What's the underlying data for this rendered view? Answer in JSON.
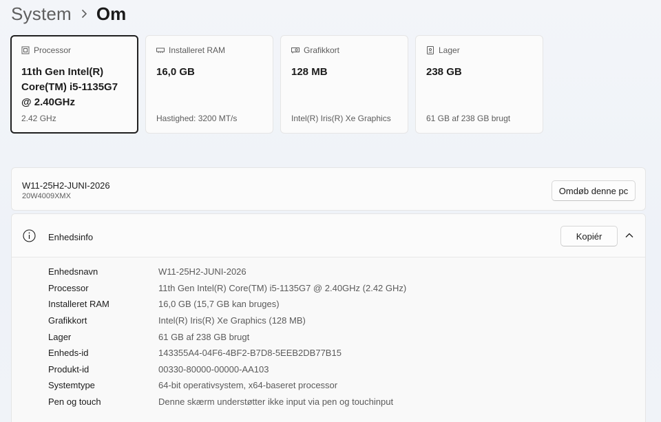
{
  "breadcrumb": {
    "parent": "System",
    "current": "Om"
  },
  "cards": [
    {
      "label": "Processor",
      "value": "11th Gen Intel(R) Core(TM) i5-1135G7 @ 2.40GHz",
      "sub": "2.42 GHz",
      "icon": "cpu-icon"
    },
    {
      "label": "Installeret RAM",
      "value": "16,0 GB",
      "sub": "Hastighed: 3200 MT/s",
      "icon": "ram-icon"
    },
    {
      "label": "Grafikkort",
      "value": "128 MB",
      "sub": "Intel(R) Iris(R) Xe Graphics",
      "icon": "gpu-icon"
    },
    {
      "label": "Lager",
      "value": "238 GB",
      "sub": "61 GB af 238 GB brugt",
      "icon": "storage-icon"
    }
  ],
  "pc": {
    "name": "W11-25H2-JUNI-2026",
    "model": "20W4009XMX",
    "rename_label": "Omdøb denne pc"
  },
  "device_info": {
    "title": "Enhedsinfo",
    "copy_label": "Kopiér",
    "rows": [
      {
        "key": "Enhedsnavn",
        "value": "W11-25H2-JUNI-2026"
      },
      {
        "key": "Processor",
        "value": "11th Gen Intel(R) Core(TM) i5-1135G7 @ 2.40GHz (2.42 GHz)"
      },
      {
        "key": "Installeret RAM",
        "value": "16,0 GB (15,7 GB kan bruges)"
      },
      {
        "key": "Grafikkort",
        "value": "Intel(R) Iris(R) Xe Graphics (128 MB)"
      },
      {
        "key": "Lager",
        "value": "61 GB af 238 GB brugt"
      },
      {
        "key": "Enheds-id",
        "value": "143355A4-04F6-4BF2-B7D8-5EEB2DB77B15"
      },
      {
        "key": "Produkt-id",
        "value": "00330-80000-00000-AA103"
      },
      {
        "key": "Systemtype",
        "value": "64-bit operativsystem, x64-baseret processor"
      },
      {
        "key": "Pen og touch",
        "value": "Denne skærm understøtter ikke input via pen og touchinput"
      }
    ]
  }
}
